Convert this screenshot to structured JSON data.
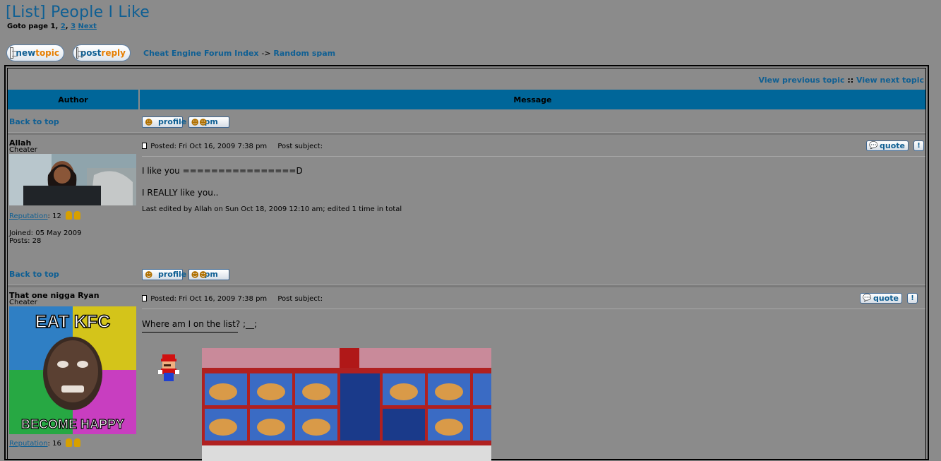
{
  "page": {
    "title": "[List] People I Like",
    "goto_label": "Goto page",
    "current_page": "1",
    "page_sep": ",",
    "pages": [
      "2",
      "3"
    ],
    "next": "Next"
  },
  "buttons": {
    "new_topic_a": "new",
    "new_topic_b": "topic",
    "post_reply_a": "post",
    "post_reply_b": "reply"
  },
  "nav": {
    "forum_index": "Cheat Engine Forum Index",
    "arrow": "->",
    "subforum": "Random spam"
  },
  "topic_nav": {
    "prev": "View previous topic",
    "sep": "::",
    "next": "View next topic"
  },
  "table": {
    "author_header": "Author",
    "message_header": "Message"
  },
  "common": {
    "back_to_top": "Back to top",
    "profile": "profile",
    "pm": "pm",
    "quote": "quote",
    "edit": "!",
    "posted_prefix": "Posted:",
    "post_subject": "Post subject:",
    "reputation": "Reputation",
    "colon": ":"
  },
  "posts": [
    {
      "author": "Allah",
      "rank": "Cheater",
      "reputation": "12",
      "joined": "Joined: 05 May 2009",
      "posts": "Posts: 28",
      "posted": "Fri Oct 16, 2009 7:38 pm",
      "body_line1": "I like you ================D",
      "body_line2": "I REALLY like you..",
      "edited": "Last edited by Allah on Sun Oct 18, 2009 12:10 am; edited 1 time in total"
    },
    {
      "author": "That one nigga Ryan",
      "rank": "Cheater",
      "reputation": "16",
      "posted": "Fri Oct 16, 2009 7:38 pm",
      "body_line1": "Where am I on the list? ;__;",
      "avatar_top": "EAT KFC",
      "avatar_bottom": "BECOME HAPPY"
    }
  ],
  "colors": {
    "background": "#8b8b8b",
    "link": "#0f5f93",
    "header": "#006699"
  }
}
